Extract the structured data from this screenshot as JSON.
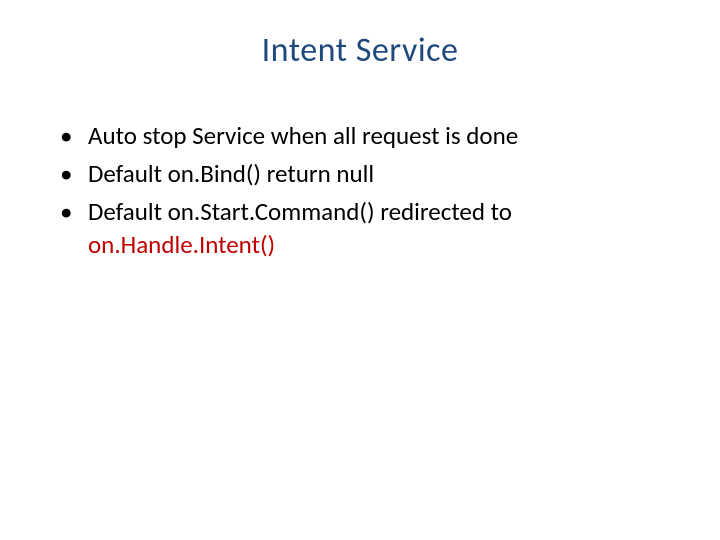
{
  "slide": {
    "title": "Intent Service",
    "bullets": [
      {
        "text": "Auto stop Service when all request is done"
      },
      {
        "text": "Default on.Bind() return null"
      },
      {
        "prefix": "Default on.Start.Command() redirected to ",
        "highlight": "on.Handle.Intent()"
      }
    ]
  }
}
